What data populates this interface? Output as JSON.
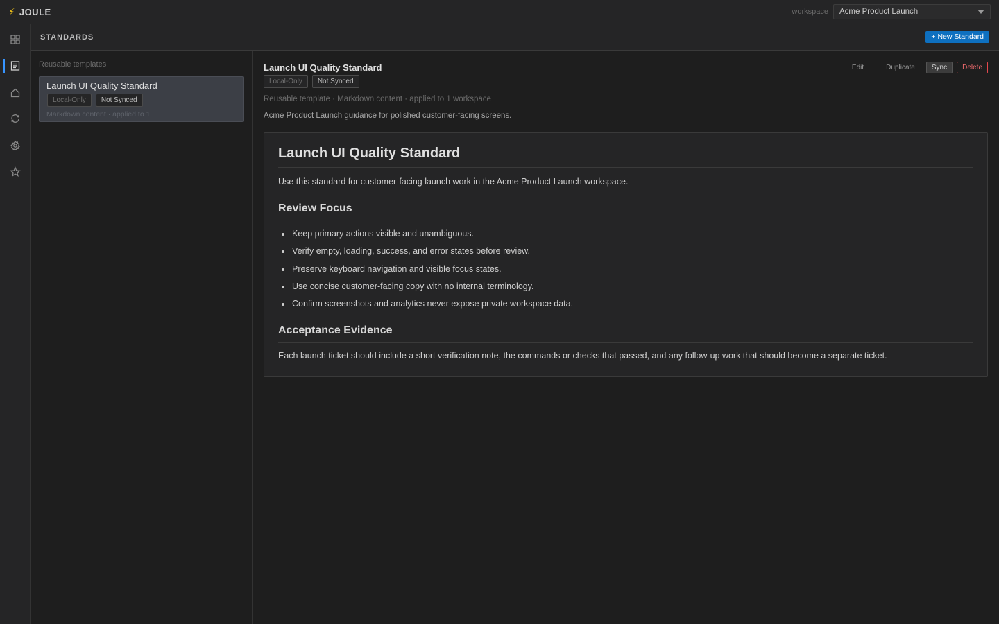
{
  "app": {
    "name": "JOULE",
    "logo_icon": "lightning-bolt-icon"
  },
  "workspace": {
    "label": "workspace",
    "selected": "Acme Product Launch"
  },
  "activity_bar": {
    "items": [
      {
        "icon": "dashboard-grid-icon",
        "active": false
      },
      {
        "icon": "standards-document-icon",
        "active": true
      },
      {
        "icon": "home-icon",
        "active": false
      },
      {
        "icon": "sync-cycle-icon",
        "active": false
      },
      {
        "icon": "gear-icon",
        "active": false
      },
      {
        "icon": "star-icon",
        "active": false
      }
    ]
  },
  "panel": {
    "title": "STANDARDS",
    "new_button": "+ New Standard"
  },
  "list": {
    "heading": "Reusable templates",
    "items": [
      {
        "title": "Launch UI Quality Standard",
        "badge_local": "Local-Only",
        "badge_sync": "Not Synced",
        "meta": "Markdown content · applied to 1"
      }
    ]
  },
  "detail": {
    "title": "Launch UI Quality Standard",
    "badge_local": "Local-Only",
    "badge_sync": "Not Synced",
    "meta": "Reusable template · Markdown content · applied to 1 workspace",
    "description": "Acme Product Launch guidance for polished customer-facing screens.",
    "actions": {
      "edit": "Edit",
      "duplicate": "Duplicate",
      "sync": "Sync",
      "delete": "Delete"
    },
    "document": {
      "h1": "Launch UI Quality Standard",
      "intro": "Use this standard for customer-facing launch work in the Acme Product Launch workspace.",
      "section1_title": "Review Focus",
      "section1_items": [
        "Keep primary actions visible and unambiguous.",
        "Verify empty, loading, success, and error states before review.",
        "Preserve keyboard navigation and visible focus states.",
        "Use concise customer-facing copy with no internal terminology.",
        "Confirm screenshots and analytics never expose private workspace data."
      ],
      "section2_title": "Acceptance Evidence",
      "section2_text": "Each launch ticket should include a short verification note, the commands or checks that passed, and any follow-up work that should become a separate ticket."
    }
  },
  "colors": {
    "accent": "#0e70c0",
    "delete": "#e5484d",
    "background": "#1e1e1e",
    "panel": "#252526"
  }
}
